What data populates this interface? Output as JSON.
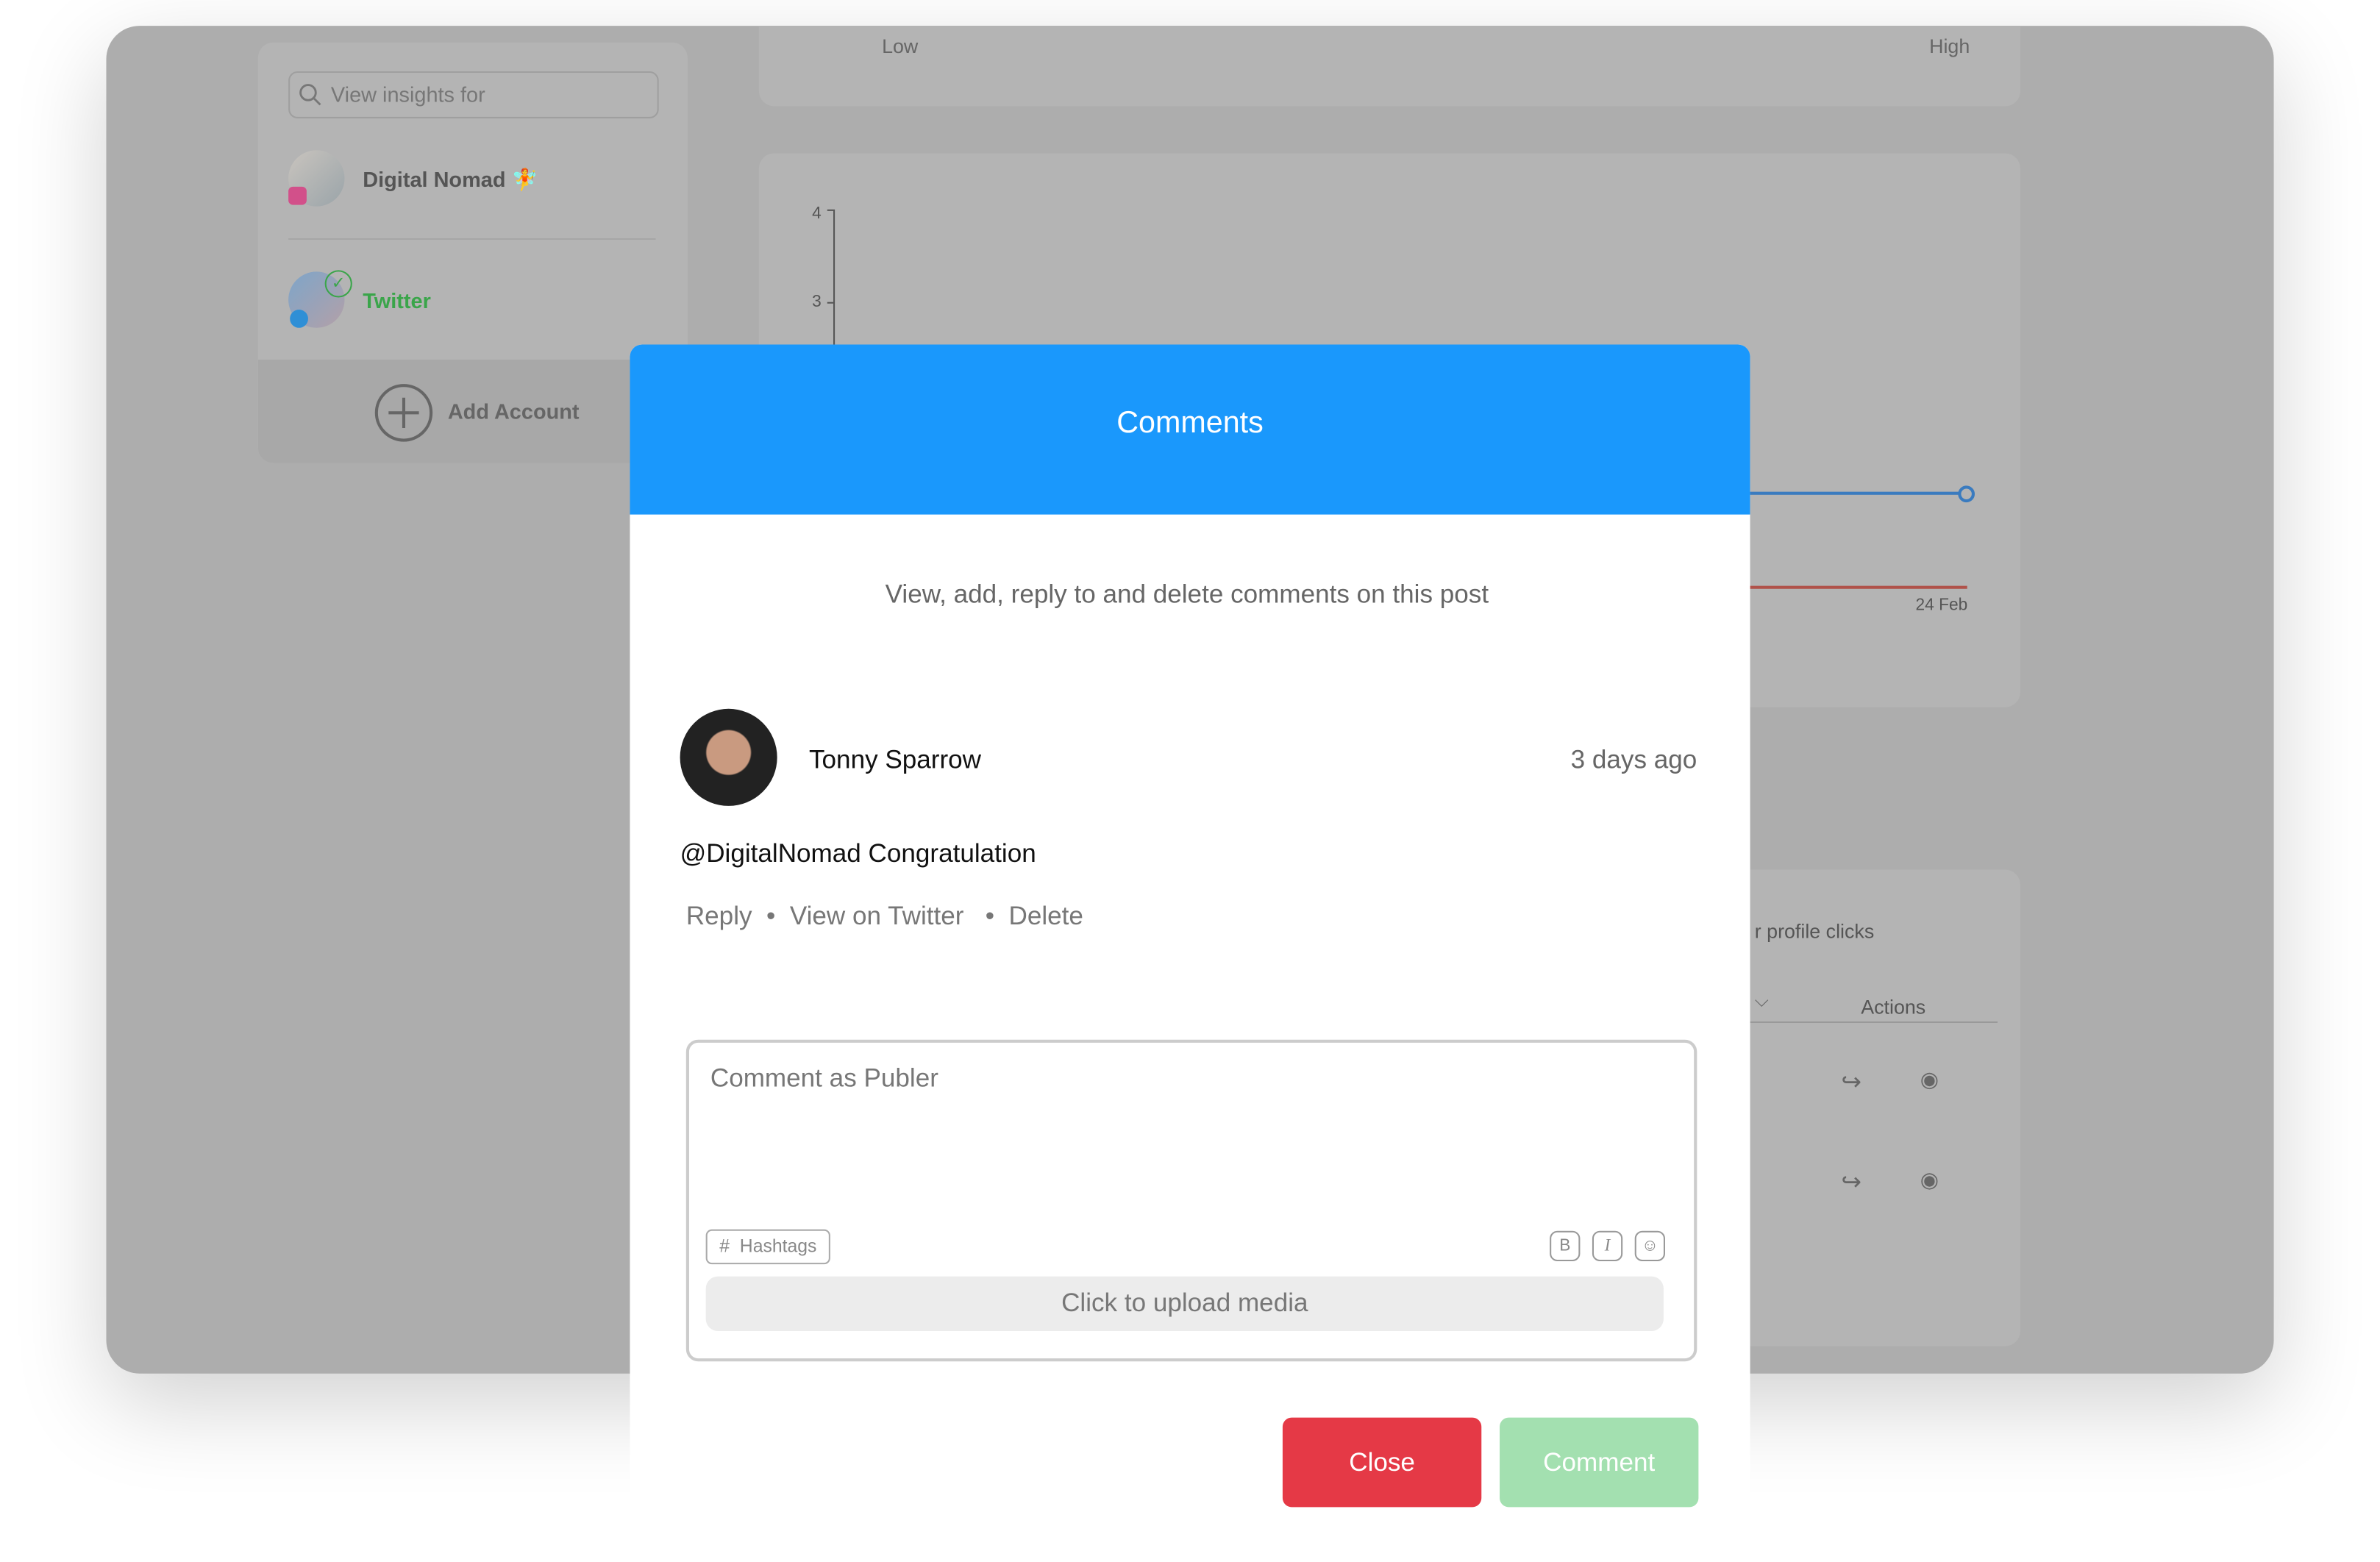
{
  "sidebar": {
    "search_placeholder": "View insights for",
    "accounts": [
      {
        "name": "Digital Nomad",
        "emoji": "🧚",
        "network": "instagram"
      },
      {
        "name": "Twitter",
        "network": "twitter",
        "selected": true
      }
    ],
    "add_account": "Add Account"
  },
  "scale_card": {
    "low": "Low",
    "high": "High"
  },
  "chart_data": {
    "type": "line",
    "y_ticks": [
      "4",
      "3"
    ],
    "x_ticks": [
      "24 Feb"
    ],
    "series_colors": [
      "#3a7bbf",
      "#b0524a"
    ]
  },
  "table": {
    "column_partial": "r profile clicks",
    "actions_header": "Actions",
    "row_icons": [
      "share-icon",
      "eye-icon"
    ]
  },
  "modal": {
    "title": "Comments",
    "subtitle": "View, add, reply to and delete comments on this post",
    "comment": {
      "author": "Tonny Sparrow",
      "time": "3 days ago",
      "text": "@DigitalNomad Congratulation",
      "actions": {
        "reply": "Reply",
        "view": "View on Twitter",
        "delete": "Delete",
        "separator": "•"
      }
    },
    "composer": {
      "placeholder": "Comment as Publer",
      "hashtags": "Hashtags",
      "hash_symbol": "#",
      "bold": "B",
      "italic": "I",
      "emoji": "☺",
      "upload": "Click to upload media"
    },
    "close": "Close",
    "submit": "Comment",
    "colors": {
      "header": "#1a98fc",
      "close": "#e53946",
      "submit": "#a3e0b0"
    }
  }
}
